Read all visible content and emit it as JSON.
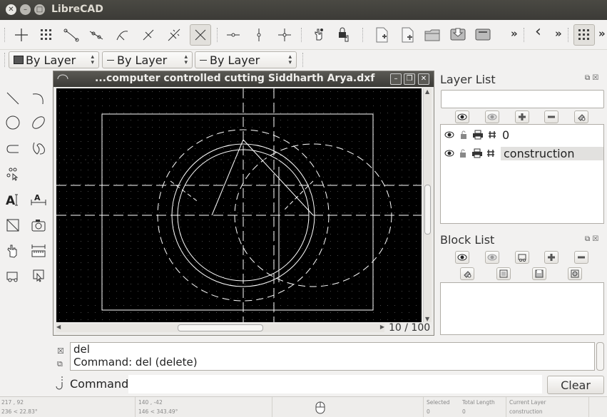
{
  "window": {
    "title": "LibreCAD"
  },
  "toolbar": {
    "overflow1": "»",
    "back_chevron": "‹",
    "overflow2": "»",
    "overflow3": "»"
  },
  "pen_toolbar": {
    "color": "By Layer",
    "line_type": "By Layer",
    "line_width": "By Layer"
  },
  "drawing": {
    "title": "...computer controlled cutting Siddharth Arya.dxf",
    "zoom": "10 / 100"
  },
  "layer_dock": {
    "title": "Layer List",
    "search_value": "",
    "layers": [
      {
        "name": "0",
        "visible": true,
        "locked": false,
        "print": true
      },
      {
        "name": "construction",
        "visible": true,
        "locked": false,
        "print": true,
        "selected": true
      }
    ]
  },
  "block_dock": {
    "title": "Block List"
  },
  "command": {
    "history": [
      "del",
      "Command: del (delete)"
    ],
    "label": "Command:",
    "input_value": "",
    "clear_label": "Clear"
  },
  "status": {
    "abs_coord": "217 , 92",
    "abs_polar": "236 < 22.83°",
    "rel_coord": "140 , -42",
    "rel_polar": "146 < 343.49°",
    "selected_label": "Selected",
    "selected_value": "0",
    "length_label": "Total Length",
    "length_value": "0",
    "layer_label": "Current Layer",
    "layer_value": "construction"
  }
}
